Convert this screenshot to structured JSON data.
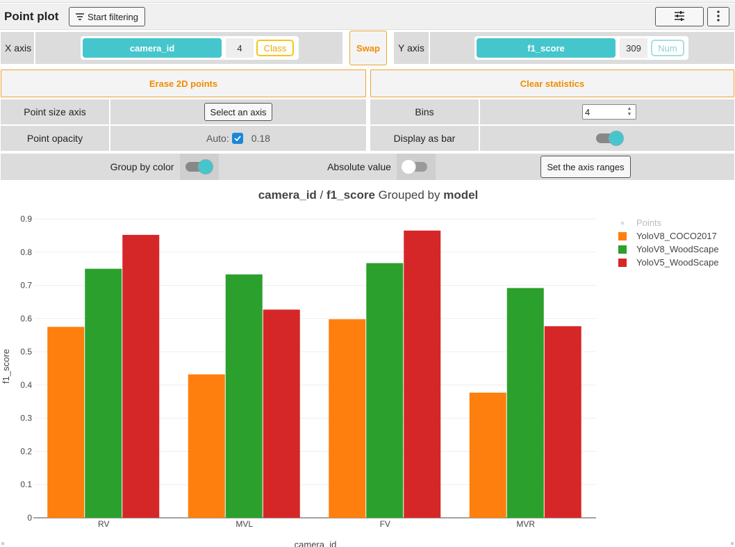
{
  "header": {
    "title": "Point plot",
    "filter_label": "Start filtering"
  },
  "axes": {
    "x_label": "X axis",
    "x_field": "camera_id",
    "x_count": "4",
    "x_type": "Class",
    "swap_label": "Swap",
    "y_label": "Y axis",
    "y_field": "f1_score",
    "y_count": "309",
    "y_type": "Num"
  },
  "actions": {
    "erase_label": "Erase 2D points",
    "clear_label": "Clear statistics"
  },
  "options": {
    "point_size_label": "Point size axis",
    "point_size_button": "Select an axis",
    "opacity_label": "Point opacity",
    "opacity_auto": "Auto:",
    "opacity_value": "0.18",
    "bins_label": "Bins",
    "bins_value": "4",
    "display_bar_label": "Display as bar",
    "display_bar_on": true,
    "group_color_label": "Group by color",
    "group_color_on": true,
    "absolute_label": "Absolute value",
    "absolute_on": false,
    "axis_ranges_label": "Set the axis ranges"
  },
  "colors": {
    "accent_teal": "#45c6cc",
    "accent_orange": "#f08c00",
    "series_orange": "#ff7f0e",
    "series_green": "#2ca02c",
    "series_red": "#d62728"
  },
  "chart_data": {
    "type": "bar",
    "title_parts": [
      "camera_id",
      " / ",
      "f1_score",
      " Grouped by ",
      "model"
    ],
    "xlabel": "camera_id",
    "ylabel": "f1_score",
    "categories": [
      "RV",
      "MVL",
      "FV",
      "MVR"
    ],
    "ylim": [
      0,
      0.9
    ],
    "yticks": [
      "0",
      "0.1",
      "0.2",
      "0.3",
      "0.4",
      "0.5",
      "0.6",
      "0.7",
      "0.8",
      "0.9"
    ],
    "legend_points_label": "Points",
    "legend_position": "top-right",
    "grid": true,
    "series": [
      {
        "name": "YoloV8_COCO2017",
        "color": "#ff7f0e",
        "values": [
          0.575,
          0.432,
          0.598,
          0.377
        ]
      },
      {
        "name": "YoloV8_WoodScape",
        "color": "#2ca02c",
        "values": [
          0.75,
          0.733,
          0.767,
          0.692
        ]
      },
      {
        "name": "YoloV5_WoodScape",
        "color": "#d62728",
        "values": [
          0.852,
          0.627,
          0.865,
          0.577
        ]
      }
    ]
  }
}
